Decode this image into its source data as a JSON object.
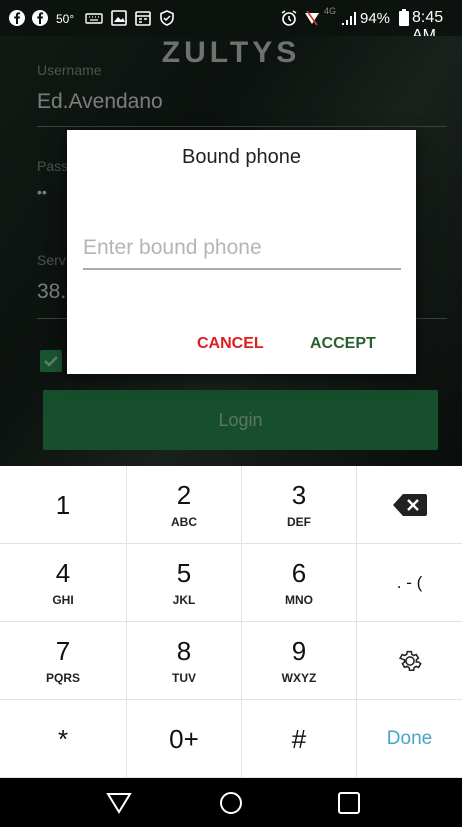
{
  "status_bar": {
    "temperature": "50°",
    "network": "4G",
    "battery": "94%",
    "time": "8:45 AM"
  },
  "app": {
    "logo": "ZULTYS",
    "username_label": "Username",
    "username_value": "Ed.Avendano",
    "password_label": "Pass",
    "password_value": "••",
    "server_label": "Serv",
    "server_value": "38.",
    "login_label": "Login"
  },
  "dialog": {
    "title": "Bound phone",
    "input_placeholder": "Enter bound phone",
    "input_value": "",
    "cancel_label": "CANCEL",
    "accept_label": "ACCEPT"
  },
  "keyboard": {
    "keys": [
      {
        "main": "1",
        "sub": ""
      },
      {
        "main": "2",
        "sub": "ABC"
      },
      {
        "main": "3",
        "sub": "DEF"
      },
      {
        "main": "backspace",
        "sub": ""
      },
      {
        "main": "4",
        "sub": "GHI"
      },
      {
        "main": "5",
        "sub": "JKL"
      },
      {
        "main": "6",
        "sub": "MNO"
      },
      {
        "main": ". - (",
        "sub": ""
      },
      {
        "main": "7",
        "sub": "PQRS"
      },
      {
        "main": "8",
        "sub": "TUV"
      },
      {
        "main": "9",
        "sub": "WXYZ"
      },
      {
        "main": "settings",
        "sub": ""
      },
      {
        "main": "*",
        "sub": ""
      },
      {
        "main": "0+",
        "sub": ""
      },
      {
        "main": "#",
        "sub": ""
      },
      {
        "main": "Done",
        "sub": ""
      }
    ]
  },
  "colors": {
    "accent_green": "#2a9150",
    "cancel_red": "#e01c1c",
    "accept_green": "#2d5e2f",
    "done_blue": "#4aa3c7"
  }
}
